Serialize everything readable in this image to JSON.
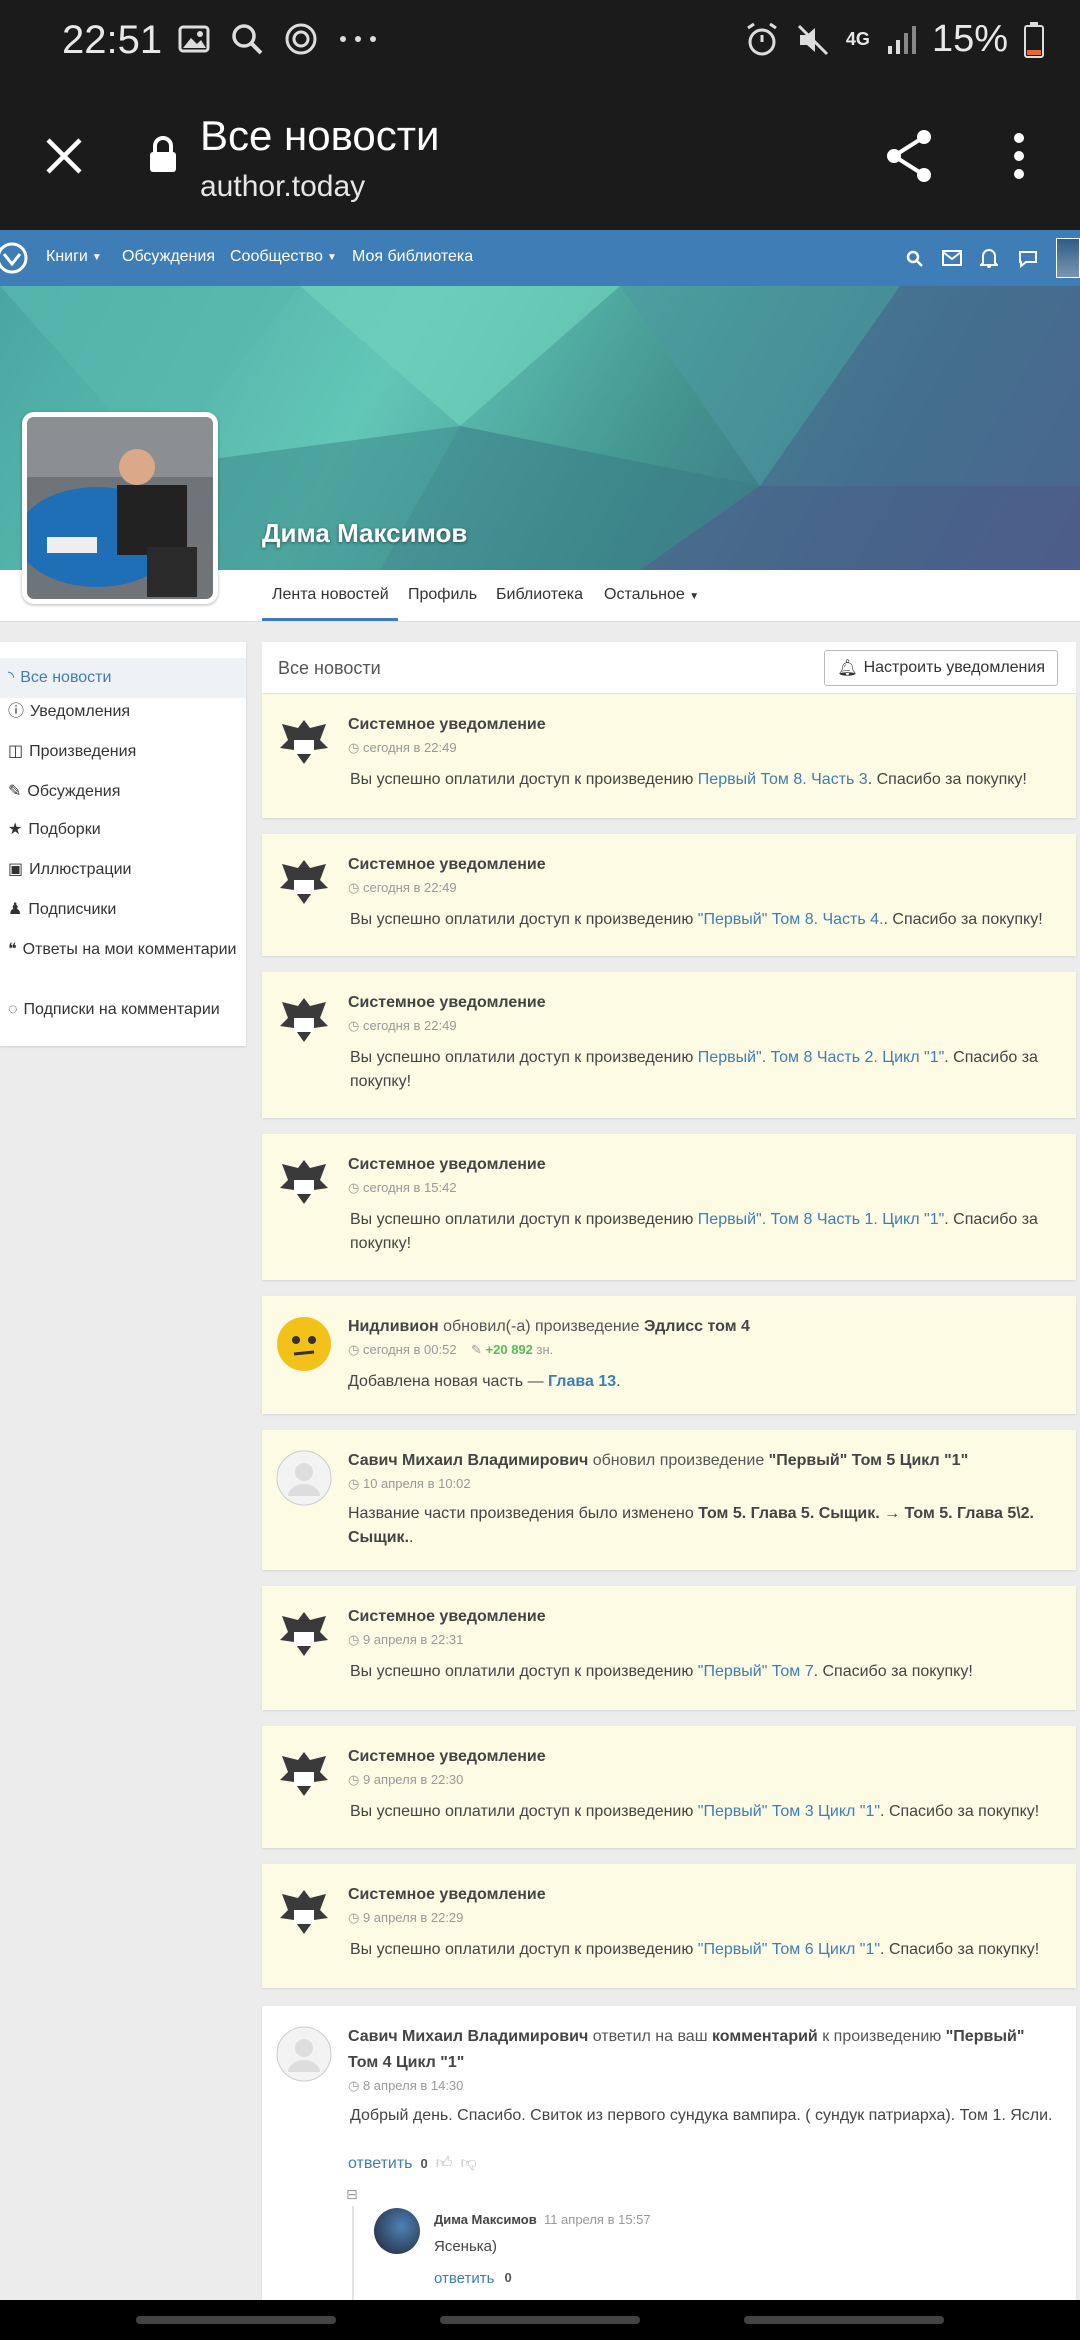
{
  "status_bar": {
    "time": "22:51",
    "network": "4G",
    "battery": "15%",
    "icons": [
      "image-icon",
      "search-icon",
      "target-icon",
      "more-icon",
      "alarm-icon",
      "mute-icon",
      "signal-icon",
      "battery-icon"
    ]
  },
  "browser": {
    "title": "Все новости",
    "url": "author.today"
  },
  "site_nav": {
    "items": [
      "Книги",
      "Обсуждения",
      "Сообщество",
      "Моя библиотека"
    ],
    "accent": "#3e7db6"
  },
  "profile": {
    "name": "Дима Максимов",
    "tabs": [
      "Лента новостей",
      "Профиль",
      "Библиотека",
      "Остальное"
    ]
  },
  "sidebar": {
    "items": [
      "Все новости",
      "Уведомления",
      "Произведения",
      "Обсуждения",
      "Подборки",
      "Иллюстрации",
      "Подписчики",
      "Ответы на мои комментарии",
      "Подписки на комментарии"
    ]
  },
  "feed": {
    "title": "Все новости",
    "notify_button": "Настроить уведомления",
    "cards": [
      {
        "author": "Системное уведомление",
        "time": "сегодня в 22:49",
        "text": "Вы успешно оплатили доступ к произведению ",
        "link": "Первый Том 8. Часть 3",
        "after": ". Спасибо за покупку!"
      },
      {
        "author": "Системное уведомление",
        "time": "сегодня в 22:49",
        "text": "Вы успешно оплатили доступ к произведению ",
        "link": "\"Первый\" Том 8. Часть 4.",
        "after": ". Спасибо за покупку!"
      },
      {
        "author": "Системное уведомление",
        "time": "сегодня в 22:49",
        "text": "Вы успешно оплатили доступ к произведению ",
        "link": "Первый\". Том 8 Часть 2. Цикл \"1\"",
        "after": ". Спасибо за покупку!"
      },
      {
        "author": "Системное уведомление",
        "time": "сегодня в 15:42",
        "text": "Вы успешно оплатили доступ к произведению ",
        "link": "Первый\". Том 8 Часть 1. Цикл \"1\"",
        "after": ". Спасибо за покупку!"
      },
      {
        "author": "Нидливион",
        "action": " обновил(-а) произведение ",
        "work": "Эдлисс том 4",
        "time": "сегодня в 00:52",
        "chars": "+20 892",
        "chars_unit": " зн.",
        "text": "Добавлена новая часть — ",
        "link": "Глава 13",
        "after": "."
      },
      {
        "author": "Савич Михаил Владимирович",
        "action": " обновил произведение ",
        "work": "\"Первый\" Том 5 Цикл \"1\"",
        "time": "10 апреля в 10:02",
        "text": "Название части произведения было изменено ",
        "old": "Том 5. Глава 5. Сыщик.",
        "arrow": " → ",
        "new": "Том 5. Глава 5\\2. Сыщик.",
        "after": "."
      },
      {
        "author": "Системное уведомление",
        "time": "9 апреля в 22:31",
        "text": "Вы успешно оплатили доступ к произведению ",
        "link": "\"Первый\" Том 7",
        "after": ". Спасибо за покупку!"
      },
      {
        "author": "Системное уведомление",
        "time": "9 апреля в 22:30",
        "text": "Вы успешно оплатили доступ к произведению ",
        "link": "\"Первый\" Том 3 Цикл \"1\"",
        "after": ". Спасибо за покупку!"
      },
      {
        "author": "Системное уведомление",
        "time": "9 апреля в 22:29",
        "text": "Вы успешно оплатили доступ к произведению ",
        "link": "\"Первый\" Том 6 Цикл \"1\"",
        "after": ". Спасибо за покупку!"
      },
      {
        "author": "Савич Михаил Владимирович",
        "action": " ответил на ваш ",
        "comment_link": "комментарий",
        "action2": " к произведению ",
        "work": "\"Первый\" Том 4 Цикл \"1\"",
        "time": "8 апреля в 14:30",
        "text": "Добрый день. Спасибо.  Свиток из первого сундука вампира. ( сундук патриарха). Том 1. Ясли.",
        "reply": "ответить",
        "votes": "0",
        "collapse": "⊟",
        "subcomment": {
          "author": "Дима Максимов",
          "time": "11 апреля в 15:57",
          "text": "Ясенька)",
          "reply": "ответить",
          "votes": "0"
        }
      }
    ]
  }
}
